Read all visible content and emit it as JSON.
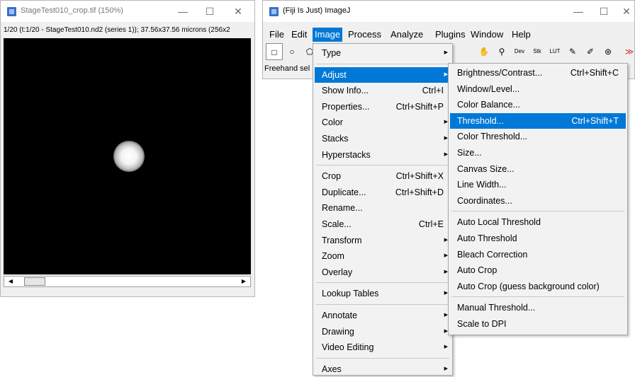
{
  "image_window": {
    "title": "StageTest010_crop.tif (150%)",
    "info": "1/20 (t:1/20 - StageTest010.nd2 (series 1)); 37.56x37.56 microns (256x2",
    "min_symbol": "—",
    "max_symbol": "☐",
    "close_symbol": "✕",
    "scroll_left": "◀",
    "scroll_right": "▶"
  },
  "imagej_window": {
    "title": "(Fiji Is Just) ImageJ",
    "min_symbol": "—",
    "max_symbol": "☐",
    "close_symbol": "✕",
    "menubar": [
      "File",
      "Edit",
      "Image",
      "Process",
      "Analyze",
      "Plugins",
      "Window",
      "Help"
    ],
    "active_menu": "Image",
    "toolbar": {
      "tools": [
        "□",
        "○",
        "⬠"
      ],
      "right_tools": [
        "✋",
        "⚲",
        "Dev",
        "Stk",
        "LUT",
        "✎",
        "✐",
        "⊛",
        "≫"
      ]
    },
    "status": "Freehand sel"
  },
  "image_menu": {
    "items": [
      {
        "label": "Type",
        "shortcut": "",
        "submenu": true
      },
      {
        "label": "Adjust",
        "shortcut": "",
        "submenu": true,
        "highlighted": true
      },
      {
        "label": "Show Info...",
        "shortcut": "Ctrl+I",
        "submenu": false
      },
      {
        "label": "Properties...",
        "shortcut": "Ctrl+Shift+P",
        "submenu": false
      },
      {
        "label": "Color",
        "shortcut": "",
        "submenu": true
      },
      {
        "label": "Stacks",
        "shortcut": "",
        "submenu": true
      },
      {
        "label": "Hyperstacks",
        "shortcut": "",
        "submenu": true
      },
      {
        "label": "Crop",
        "shortcut": "Ctrl+Shift+X",
        "submenu": false
      },
      {
        "label": "Duplicate...",
        "shortcut": "Ctrl+Shift+D",
        "submenu": false
      },
      {
        "label": "Rename...",
        "shortcut": "",
        "submenu": false
      },
      {
        "label": "Scale...",
        "shortcut": "Ctrl+E",
        "submenu": false
      },
      {
        "label": "Transform",
        "shortcut": "",
        "submenu": true
      },
      {
        "label": "Zoom",
        "shortcut": "",
        "submenu": true
      },
      {
        "label": "Overlay",
        "shortcut": "",
        "submenu": true
      },
      {
        "label": "Lookup Tables",
        "shortcut": "",
        "submenu": true
      },
      {
        "label": "Annotate",
        "shortcut": "",
        "submenu": true
      },
      {
        "label": "Drawing",
        "shortcut": "",
        "submenu": true
      },
      {
        "label": "Video Editing",
        "shortcut": "",
        "submenu": true
      },
      {
        "label": "Axes",
        "shortcut": "",
        "submenu": true
      }
    ]
  },
  "adjust_menu": {
    "items": [
      {
        "label": "Brightness/Contrast...",
        "shortcut": "Ctrl+Shift+C"
      },
      {
        "label": "Window/Level...",
        "shortcut": ""
      },
      {
        "label": "Color Balance...",
        "shortcut": ""
      },
      {
        "label": "Threshold...",
        "shortcut": "Ctrl+Shift+T",
        "highlighted": true
      },
      {
        "label": "Color Threshold...",
        "shortcut": ""
      },
      {
        "label": "Size...",
        "shortcut": ""
      },
      {
        "label": "Canvas Size...",
        "shortcut": ""
      },
      {
        "label": "Line Width...",
        "shortcut": ""
      },
      {
        "label": "Coordinates...",
        "shortcut": ""
      },
      {
        "label": "Auto Local Threshold",
        "shortcut": ""
      },
      {
        "label": "Auto Threshold",
        "shortcut": ""
      },
      {
        "label": "Bleach Correction",
        "shortcut": ""
      },
      {
        "label": "Auto Crop",
        "shortcut": ""
      },
      {
        "label": "Auto Crop (guess background color)",
        "shortcut": ""
      },
      {
        "label": "Manual Threshold...",
        "shortcut": ""
      },
      {
        "label": "Scale to DPI",
        "shortcut": ""
      }
    ]
  },
  "colors": {
    "highlight": "#0078d7",
    "menu_bg": "#f2f2f2",
    "window_bg": "#f0f0f0"
  }
}
